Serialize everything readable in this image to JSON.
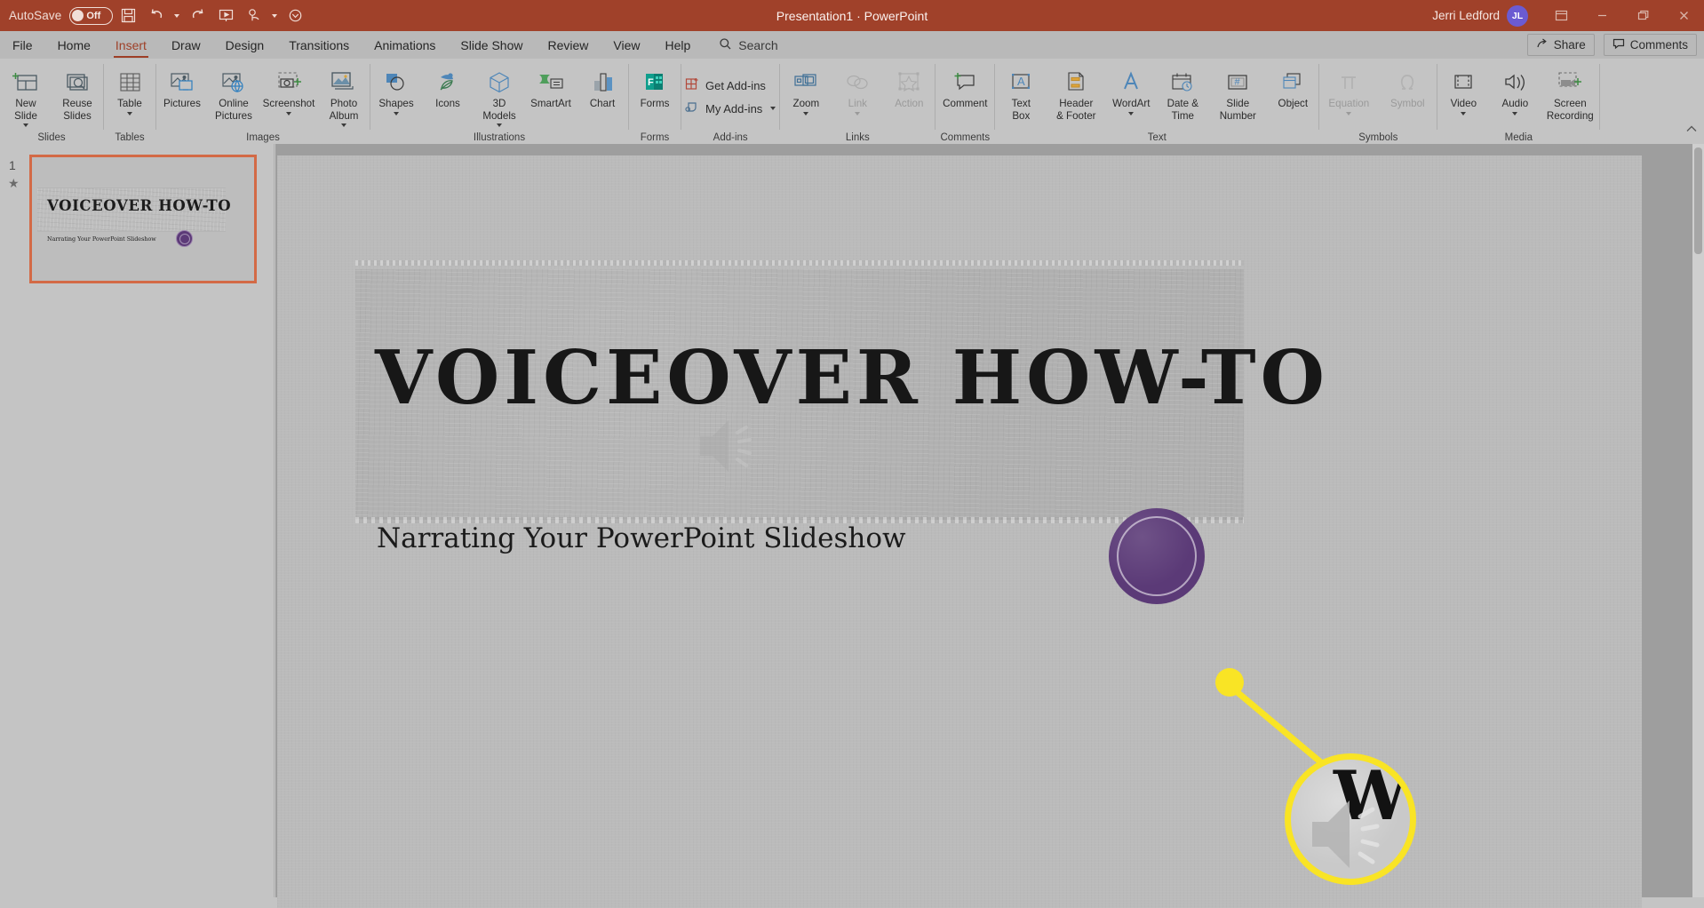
{
  "titlebar": {
    "autosave_label": "AutoSave",
    "autosave_state": "Off",
    "document_title": "Presentation1  ·  PowerPoint",
    "user_name": "Jerri Ledford",
    "avatar_initials": "JL",
    "quick_access": [
      {
        "name": "save-icon",
        "label": "Save"
      },
      {
        "name": "undo-icon",
        "label": "Undo"
      },
      {
        "name": "redo-icon",
        "label": "Redo"
      },
      {
        "name": "start-from-beginning-icon",
        "label": "Start From Beginning"
      },
      {
        "name": "touch-mode-icon",
        "label": "Touch/Mouse Mode"
      },
      {
        "name": "customize-qat-icon",
        "label": "Customize Quick Access Toolbar"
      }
    ],
    "window_controls": [
      {
        "name": "ribbon-display-options-icon",
        "label": "Ribbon Display Options"
      },
      {
        "name": "minimize-icon",
        "label": "Minimize"
      },
      {
        "name": "restore-icon",
        "label": "Restore Down"
      },
      {
        "name": "close-icon",
        "label": "Close"
      }
    ],
    "bg_color": "#a0412a"
  },
  "tabs": [
    {
      "label": "File",
      "active": false
    },
    {
      "label": "Home",
      "active": false
    },
    {
      "label": "Insert",
      "active": true
    },
    {
      "label": "Draw",
      "active": false
    },
    {
      "label": "Design",
      "active": false
    },
    {
      "label": "Transitions",
      "active": false
    },
    {
      "label": "Animations",
      "active": false
    },
    {
      "label": "Slide Show",
      "active": false
    },
    {
      "label": "Review",
      "active": false
    },
    {
      "label": "View",
      "active": false
    },
    {
      "label": "Help",
      "active": false
    }
  ],
  "search": {
    "label": "Search",
    "placeholder": "Search"
  },
  "tabbar_actions": [
    {
      "label": "Share",
      "icon": "share-icon"
    },
    {
      "label": "Comments",
      "icon": "comments-icon"
    }
  ],
  "ribbon": {
    "active_tab": "Insert",
    "accent_color": "#9e3f27",
    "groups": [
      {
        "label": "Slides",
        "items": [
          {
            "label": "New\nSlide",
            "icon": "new-slide-icon",
            "caret": true,
            "disabled": false
          },
          {
            "label": "Reuse\nSlides",
            "icon": "reuse-slides-icon",
            "caret": false,
            "disabled": false
          }
        ]
      },
      {
        "label": "Tables",
        "items": [
          {
            "label": "Table",
            "icon": "table-icon",
            "caret": true,
            "disabled": false
          }
        ]
      },
      {
        "label": "Images",
        "items": [
          {
            "label": "Pictures",
            "icon": "pictures-icon",
            "caret": false,
            "disabled": false
          },
          {
            "label": "Online\nPictures",
            "icon": "online-pictures-icon",
            "caret": false,
            "disabled": false
          },
          {
            "label": "Screenshot",
            "icon": "screenshot-icon",
            "caret": true,
            "disabled": false
          },
          {
            "label": "Photo\nAlbum",
            "icon": "photo-album-icon",
            "caret": true,
            "disabled": false
          }
        ]
      },
      {
        "label": "Illustrations",
        "items": [
          {
            "label": "Shapes",
            "icon": "shapes-icon",
            "caret": true,
            "disabled": false
          },
          {
            "label": "Icons",
            "icon": "icons-icon",
            "caret": false,
            "disabled": false
          },
          {
            "label": "3D\nModels",
            "icon": "3d-models-icon",
            "caret": true,
            "disabled": false
          },
          {
            "label": "SmartArt",
            "icon": "smartart-icon",
            "caret": false,
            "disabled": false
          },
          {
            "label": "Chart",
            "icon": "chart-icon",
            "caret": false,
            "disabled": false
          }
        ]
      },
      {
        "label": "Forms",
        "items": [
          {
            "label": "Forms",
            "icon": "forms-icon",
            "caret": false,
            "disabled": false
          }
        ]
      },
      {
        "label": "Add-ins",
        "small_items": [
          {
            "label": "Get Add-ins",
            "icon": "get-addins-icon",
            "caret": false
          },
          {
            "label": "My Add-ins",
            "icon": "my-addins-icon",
            "caret": true
          }
        ]
      },
      {
        "label": "Links",
        "items": [
          {
            "label": "Zoom",
            "icon": "zoom-icon",
            "caret": true,
            "disabled": false
          },
          {
            "label": "Link",
            "icon": "link-icon",
            "caret": true,
            "disabled": true
          },
          {
            "label": "Action",
            "icon": "action-icon",
            "caret": false,
            "disabled": true
          }
        ]
      },
      {
        "label": "Comments",
        "items": [
          {
            "label": "Comment",
            "icon": "comment-icon",
            "caret": false,
            "disabled": false
          }
        ]
      },
      {
        "label": "Text",
        "items": [
          {
            "label": "Text\nBox",
            "icon": "text-box-icon",
            "caret": false,
            "disabled": false
          },
          {
            "label": "Header\n& Footer",
            "icon": "header-footer-icon",
            "caret": false,
            "disabled": false
          },
          {
            "label": "WordArt",
            "icon": "wordart-icon",
            "caret": true,
            "disabled": false
          },
          {
            "label": "Date &\nTime",
            "icon": "date-time-icon",
            "caret": false,
            "disabled": false
          },
          {
            "label": "Slide\nNumber",
            "icon": "slide-number-icon",
            "caret": false,
            "disabled": false
          },
          {
            "label": "Object",
            "icon": "object-icon",
            "caret": false,
            "disabled": false
          }
        ]
      },
      {
        "label": "Symbols",
        "items": [
          {
            "label": "Equation",
            "icon": "equation-icon",
            "caret": true,
            "disabled": true
          },
          {
            "label": "Symbol",
            "icon": "symbol-icon",
            "caret": false,
            "disabled": true
          }
        ]
      },
      {
        "label": "Media",
        "items": [
          {
            "label": "Video",
            "icon": "video-icon",
            "caret": true,
            "disabled": false
          },
          {
            "label": "Audio",
            "icon": "audio-icon",
            "caret": true,
            "disabled": false
          },
          {
            "label": "Screen\nRecording",
            "icon": "screen-recording-icon",
            "caret": false,
            "disabled": false
          }
        ]
      }
    ]
  },
  "slide_pane": {
    "slides": [
      {
        "number": "1",
        "title": "VOICEOVER HOW-TO",
        "subtitle": "Narrating Your PowerPoint Slideshow",
        "selected": true,
        "has_animation_star": true
      }
    ]
  },
  "slide": {
    "title": "VOICEOVER  HOW-TO",
    "subtitle": "Narrating Your PowerPoint Slideshow",
    "background_color": "#bbbbbb",
    "band_color": "#b0b0b0",
    "stamp_color": "#5b3a77",
    "callout_color": "#f9e425",
    "objects": [
      {
        "name": "title-placeholder",
        "type": "text"
      },
      {
        "name": "subtitle-placeholder",
        "type": "text"
      },
      {
        "name": "purple-stamp-shape",
        "type": "shape"
      },
      {
        "name": "audio-clip-icon",
        "type": "media",
        "selected": true
      },
      {
        "name": "zoom-callout-annotation",
        "type": "annotation"
      }
    ]
  }
}
